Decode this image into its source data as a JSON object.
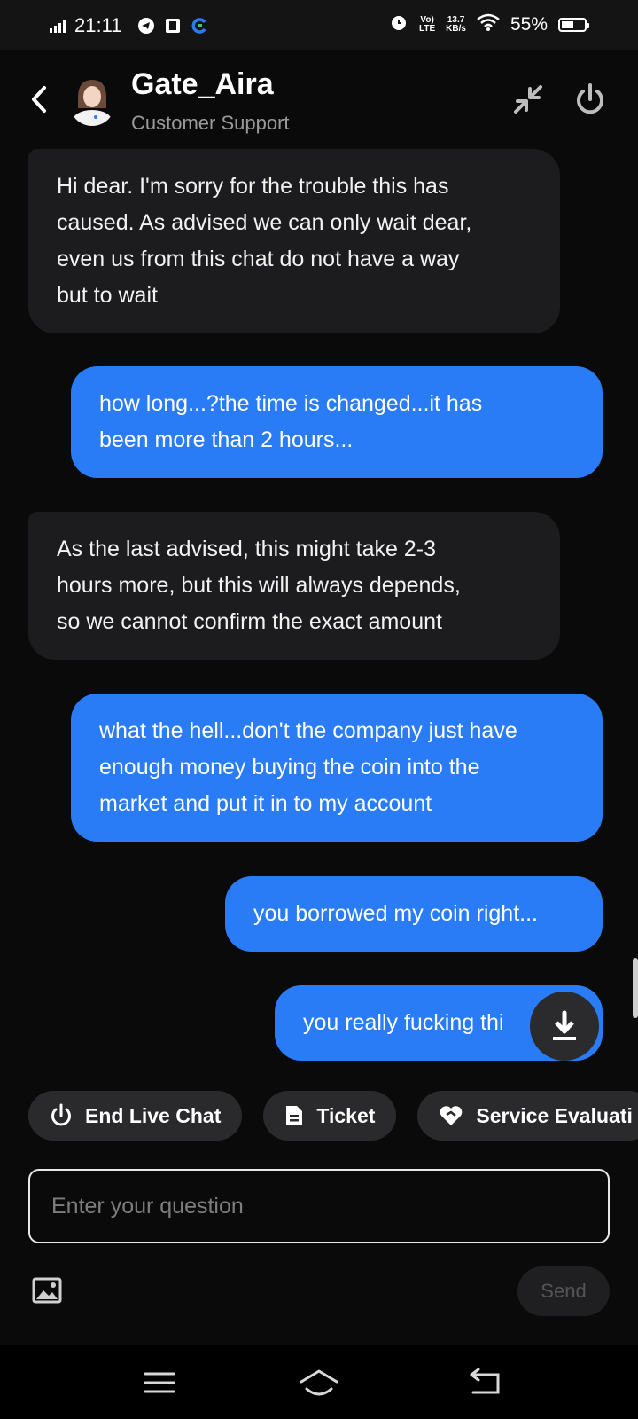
{
  "status_bar": {
    "time": "21:11",
    "net_type_top": "Vo)",
    "net_type_bottom": "LTE",
    "speed_value": "13.7",
    "speed_unit": "KB/s",
    "battery": "55%",
    "battery_level": 0.55
  },
  "header": {
    "agent_name": "Gate_Aira",
    "agent_role": "Customer Support"
  },
  "messages": [
    {
      "from": "agent",
      "lines": [
        "Hi dear. I'm sorry for the trouble this has",
        "caused. As advised we can only wait dear,",
        "even us from this chat do not have a way",
        "but to wait"
      ]
    },
    {
      "from": "user",
      "lines": [
        "how long...?the time is changed...it has",
        "been more than 2 hours..."
      ]
    },
    {
      "from": "agent",
      "lines": [
        "As the last advised, this might take 2-3",
        "hours more, but this will always depends,",
        "so we cannot confirm the exact amount"
      ]
    },
    {
      "from": "user",
      "lines": [
        "what the hell...don't the company just have",
        "enough money buying the coin into the",
        "market and put it in to my account"
      ]
    },
    {
      "from": "user",
      "lines": [
        "you borrowed my coin right..."
      ]
    },
    {
      "from": "user",
      "lines": [
        "you really fucking thi"
      ]
    }
  ],
  "quick_actions": {
    "end_live_chat": "End Live Chat",
    "ticket": "Ticket",
    "service_evaluation": "Service Evaluati"
  },
  "composer": {
    "placeholder": "Enter your question",
    "value": "",
    "send_label": "Send"
  },
  "icons": {
    "back": "chevron-left-icon",
    "minimize": "minimize-arrows-icon",
    "power": "power-icon",
    "download": "download-icon",
    "image": "image-icon"
  },
  "colors": {
    "user_bubble": "#2a7cf6",
    "agent_bubble": "#1c1c1e",
    "background": "#0a0a0a"
  }
}
